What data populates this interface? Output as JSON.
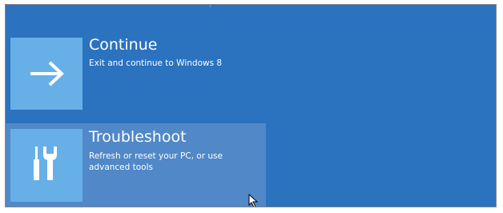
{
  "colors": {
    "background": "#2b72bf",
    "tile": "#66b0e7",
    "hover_row": "#5088c8",
    "text": "#ffffff"
  },
  "options": [
    {
      "title": "Continue",
      "description": "Exit and continue to Windows 8",
      "icon": "arrow-right-icon"
    },
    {
      "title": "Troubleshoot",
      "description": "Refresh or reset your PC, or use advanced tools",
      "icon": "tools-icon"
    }
  ]
}
